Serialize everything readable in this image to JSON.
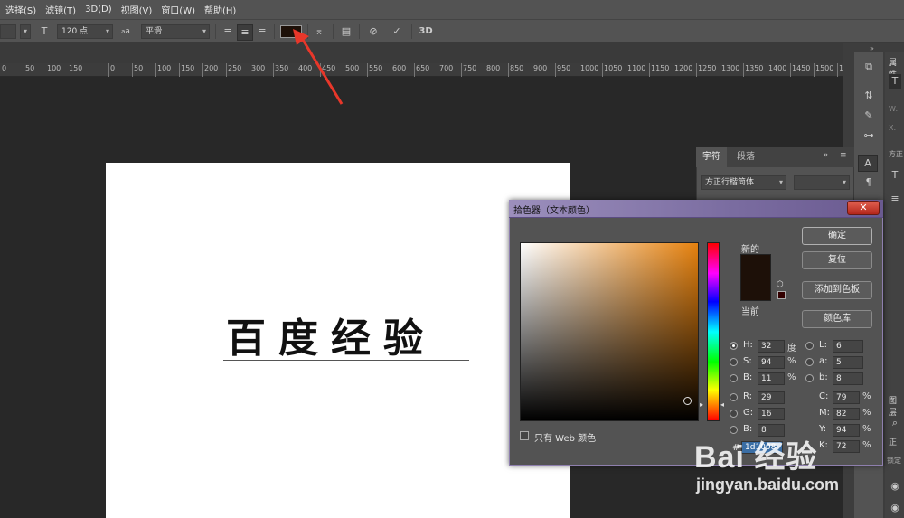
{
  "menu": [
    "选择(S)",
    "滤镜(T)",
    "3D(D)",
    "视图(V)",
    "窗口(W)",
    "帮助(H)"
  ],
  "options": {
    "font_size": "120 点",
    "antialias_icon": "a",
    "antialias": "平滑",
    "text_color": "#1d1008",
    "threed": "3D"
  },
  "ruler": [
    "0",
    "50",
    "100",
    "150",
    "200",
    "250",
    "300",
    "350",
    "400",
    "450",
    "500",
    "550",
    "600",
    "650",
    "700",
    "750",
    "800",
    "850",
    "900",
    "950",
    "1000",
    "1050",
    "1100",
    "1150",
    "1200",
    "1250",
    "1300",
    "1350",
    "1400",
    "1450",
    "1500",
    "155"
  ],
  "ruler_left": [
    "0",
    "50",
    "100",
    "150"
  ],
  "canvas": {
    "text": "百度经验"
  },
  "char_panel": {
    "tab_char": "字符",
    "tab_para": "段落",
    "font_family": "方正行楷简体"
  },
  "right_panel": {
    "props_label": "属性",
    "font_label": "方正",
    "layers_label": "图层",
    "zheng": "正",
    "jiading": "锁定",
    "w": "W:",
    "x": "X:"
  },
  "picker": {
    "title": "拾色器（文本颜色）",
    "new_label": "新的",
    "current_label": "当前",
    "ok": "确定",
    "reset": "复位",
    "add_swatch": "添加到色板",
    "libraries": "颜色库",
    "web_only": "只有 Web 颜色",
    "h_label": "H:",
    "h": "32",
    "h_unit": "度",
    "s_label": "S:",
    "s": "94",
    "s_unit": "%",
    "b_label": "B:",
    "b": "11",
    "b_unit": "%",
    "r_label": "R:",
    "r": "29",
    "g_label": "G:",
    "g": "16",
    "bb_label": "B:",
    "bb": "8",
    "l_label": "L:",
    "l": "6",
    "a_label": "a:",
    "a": "5",
    "lb_label": "b:",
    "lb": "8",
    "c_label": "C:",
    "c": "79",
    "c_unit": "%",
    "m_label": "M:",
    "m": "82",
    "m_unit": "%",
    "y_label": "Y:",
    "y": "94",
    "y_unit": "%",
    "k_label": "K:",
    "k": "72",
    "k_unit": "%",
    "hex_label": "#",
    "hex": "1d1008",
    "new_color": "#1d1008"
  },
  "watermark": {
    "brand": "Bai 经验",
    "url": "jingyan.baidu.com"
  }
}
